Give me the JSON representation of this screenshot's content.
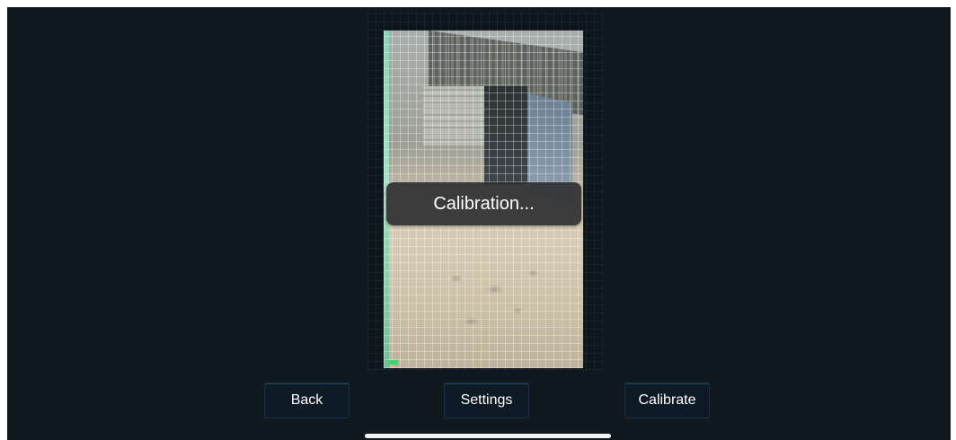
{
  "toast": {
    "text": "Calibration..."
  },
  "toolbar": {
    "back_label": "Back",
    "settings_label": "Settings",
    "calibrate_label": "Calibrate"
  },
  "colors": {
    "background": "#101820",
    "button_bg": "#0e1a26",
    "toast_bg": "#303234",
    "text": "#ffffff"
  }
}
